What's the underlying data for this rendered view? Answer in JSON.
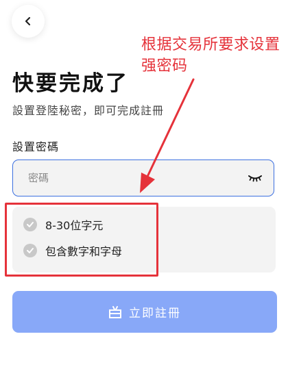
{
  "header": {
    "back_icon": "chevron-left-icon"
  },
  "main": {
    "title": "快要完成了",
    "subtitle": "設置登陸秘密，即可完成註冊",
    "field_label": "設置密碼",
    "password": {
      "value": "",
      "placeholder": "密碼",
      "toggle_icon": "eye-closed-icon"
    },
    "rules": [
      {
        "text": "8-30位字元",
        "icon": "check-circle-icon"
      },
      {
        "text": "包含數字和字母",
        "icon": "check-circle-icon"
      }
    ],
    "register_button": {
      "label": "立即註冊",
      "icon": "gift-icon"
    }
  },
  "annotation": {
    "text": "根据交易所要求设置强密码"
  },
  "colors": {
    "accent": "#3b6fe0",
    "button": "#88a8f8",
    "annotation": "#e5323a",
    "field_bg": "#f3f3f3"
  }
}
